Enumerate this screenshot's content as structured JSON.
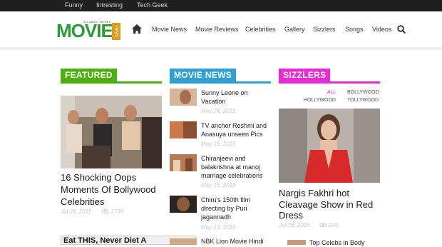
{
  "topbar": {
    "links": [
      "Funny",
      "Intresting",
      "Tech Geek"
    ]
  },
  "logo": {
    "text": "MOVIE",
    "tagline": "ALL ABOUT MOVIES",
    "side": "NEWS"
  },
  "nav": [
    "Movie News",
    "Movie Reviews",
    "Celebrities",
    "Gallery",
    "Sizzlers",
    "Songs",
    "Videos"
  ],
  "colors": {
    "featured": "#4caf0a",
    "movie_news": "#2f9fd6",
    "sizzlers": "#e82bd6",
    "topbar": "#1f1f1f"
  },
  "featured": {
    "label": "FEATURED",
    "title": "16 Shocking Oops Moments Of Bollywood Celebrities",
    "date": "Jul 29, 2015",
    "views": "1739"
  },
  "movie_news": {
    "label": "MOVIE NEWS",
    "items": [
      {
        "title": "Sunny Leone on Vacation",
        "date": "May 24, 2015"
      },
      {
        "title": "TV anchor Reshmi and Anasuya unseen Pics",
        "date": "May 15, 2015"
      },
      {
        "title": "Chiranjeevi and balakrishna at manoj marriage celebrations",
        "date": "May 15, 2015"
      },
      {
        "title": "Chiru's 150th film directing by Puri jagannadh",
        "date": "May 13, 2015"
      },
      {
        "title": "NBK Lion Movie Hindi",
        "date": ""
      }
    ]
  },
  "sizzlers": {
    "label": "SIZZLERS",
    "tabs": [
      "ALL",
      "BOLLYWOOD",
      "HOLLYWOOD",
      "TOLLYWOOD"
    ],
    "title": "Nargis Fakhri hot Cleavage Show in Red Dress",
    "date": "Jul 28, 2015",
    "views": "249",
    "next_title": "Top Celebs in Body"
  },
  "ad": {
    "text": "Eat THIS, Never Diet A"
  }
}
